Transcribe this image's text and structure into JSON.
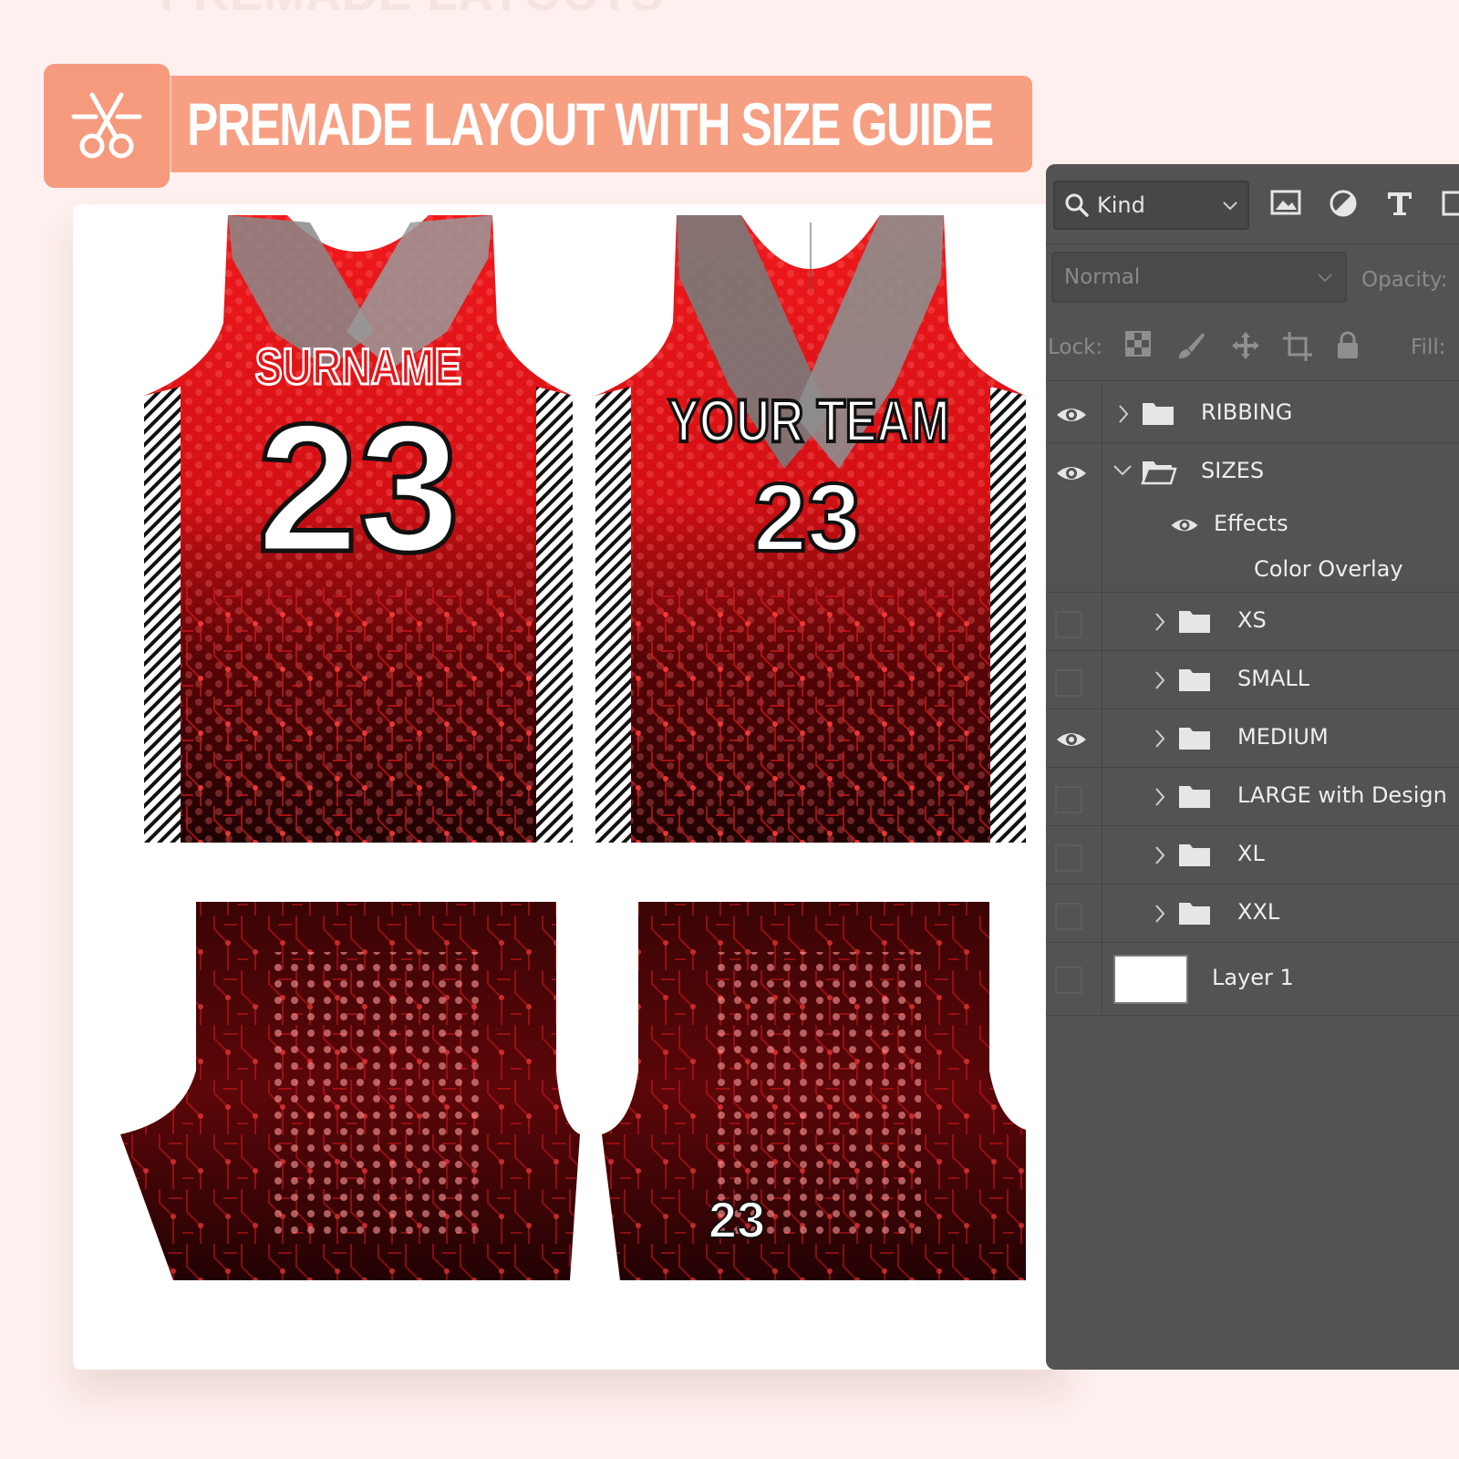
{
  "banner": {
    "ghost_title": "PREMADE LAYOUTS",
    "title": "PREMADE LAYOUT WITH SIZE GUIDE",
    "icon": "scissors-icon",
    "color": "#f79f83"
  },
  "jerseys": {
    "back_surname": "SURNAME",
    "back_number": "23",
    "front_team": "YOUR TEAM",
    "front_number": "23",
    "shorts_number": "23",
    "colors": {
      "primary": "#e0181b",
      "dark": "#2a0304",
      "white": "#ffffff"
    }
  },
  "layers_panel": {
    "filter": {
      "kind_label": "Kind",
      "icons": [
        "search-icon",
        "image-filter-icon",
        "adjustment-filter-icon",
        "type-filter-icon",
        "shape-filter-icon"
      ]
    },
    "blend_mode": "Normal",
    "opacity_label": "Opacity:",
    "lock_label": "Lock:",
    "fill_label": "Fill:",
    "layers": [
      {
        "name": "RIBBING",
        "type": "group",
        "visible": true,
        "expanded": false
      },
      {
        "name": "SIZES",
        "type": "group",
        "visible": true,
        "expanded": true
      },
      {
        "name": "Effects",
        "type": "effects",
        "visible": true
      },
      {
        "name": "Color Overlay",
        "type": "effect"
      },
      {
        "name": "XS",
        "type": "group",
        "visible": false
      },
      {
        "name": "SMALL",
        "type": "group",
        "visible": false
      },
      {
        "name": "MEDIUM",
        "type": "group",
        "visible": true
      },
      {
        "name": "LARGE with Design",
        "type": "group",
        "visible": false
      },
      {
        "name": "XL",
        "type": "group",
        "visible": false
      },
      {
        "name": "XXL",
        "type": "group",
        "visible": false
      },
      {
        "name": "Layer 1",
        "type": "layer",
        "visible": false
      }
    ]
  }
}
